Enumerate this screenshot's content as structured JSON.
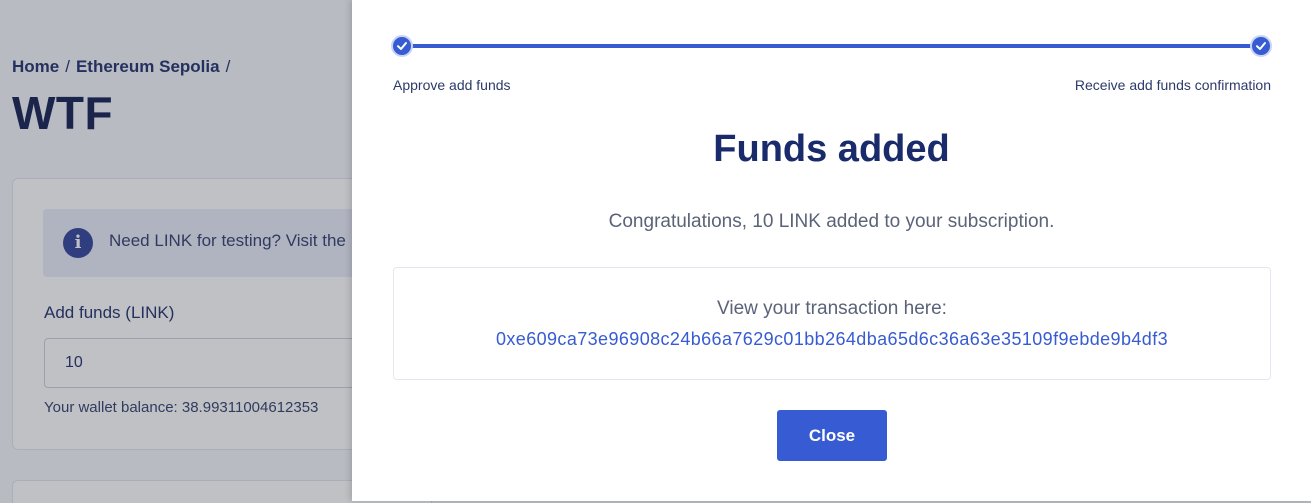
{
  "background": {
    "breadcrumb": {
      "home": "Home",
      "network": "Ethereum Sepolia",
      "separator": "/"
    },
    "page_title": "WTF",
    "info_banner": {
      "icon": "info-icon",
      "icon_glyph": "i",
      "text": "Need LINK for testing? Visit the"
    },
    "add_funds": {
      "label": "Add funds (LINK)",
      "value": "10"
    },
    "wallet_balance": "Your wallet balance: 38.99311004612353"
  },
  "modal": {
    "stepper": {
      "steps": [
        {
          "label": "Approve add funds",
          "completed": true
        },
        {
          "label": "Receive add funds confirmation",
          "completed": true
        }
      ]
    },
    "title": "Funds added",
    "message": "Congratulations, 10 LINK added to your subscription.",
    "transaction": {
      "label": "View your transaction here:",
      "hash": "0xe609ca73e96908c24b66a7629c01bb264dba65d6c36a63e35109f9ebde9b4df3"
    },
    "close_label": "Close"
  },
  "colors": {
    "accent": "#375bd2",
    "heading": "#1a2b6b",
    "muted_text": "#5a6378"
  }
}
